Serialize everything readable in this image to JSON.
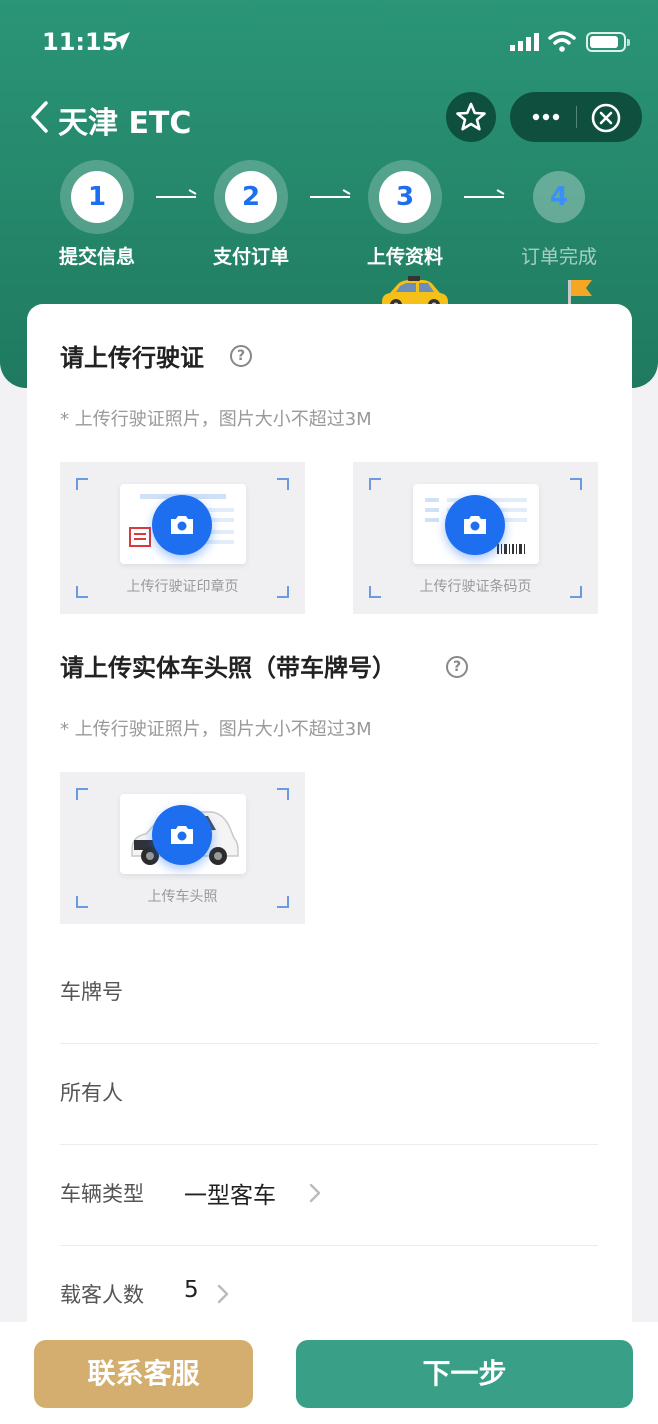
{
  "status_bar": {
    "time": "11:15"
  },
  "nav": {
    "title": "天津 ETC"
  },
  "steps": [
    {
      "number": "1",
      "label": "提交信息",
      "state": "done"
    },
    {
      "number": "2",
      "label": "支付订单",
      "state": "done"
    },
    {
      "number": "3",
      "label": "上传资料",
      "state": "current"
    },
    {
      "number": "4",
      "label": "订单完成",
      "state": "pending"
    }
  ],
  "section1": {
    "title": "请上传行驶证",
    "hint": "* 上传行驶证照片，图片大小不超过3M",
    "uploads": [
      {
        "label": "上传行驶证印章页"
      },
      {
        "label": "上传行驶证条码页"
      }
    ]
  },
  "section2": {
    "title": "请上传实体车头照（带车牌号）",
    "hint": "* 上传行驶证照片，图片大小不超过3M",
    "uploads": [
      {
        "label": "上传车头照"
      }
    ]
  },
  "fields": [
    {
      "label": "车牌号",
      "value": ""
    },
    {
      "label": "所有人",
      "value": ""
    },
    {
      "label": "车辆类型",
      "value": "一型客车"
    },
    {
      "label": "载客人数",
      "value": "5"
    }
  ],
  "actions": {
    "service": "联系客服",
    "next": "下一步"
  },
  "colors": {
    "brand_green": "#2b9577",
    "accent_blue": "#1e6ff0",
    "gold": "#d4ae6e",
    "next_green": "#3a9f87"
  }
}
